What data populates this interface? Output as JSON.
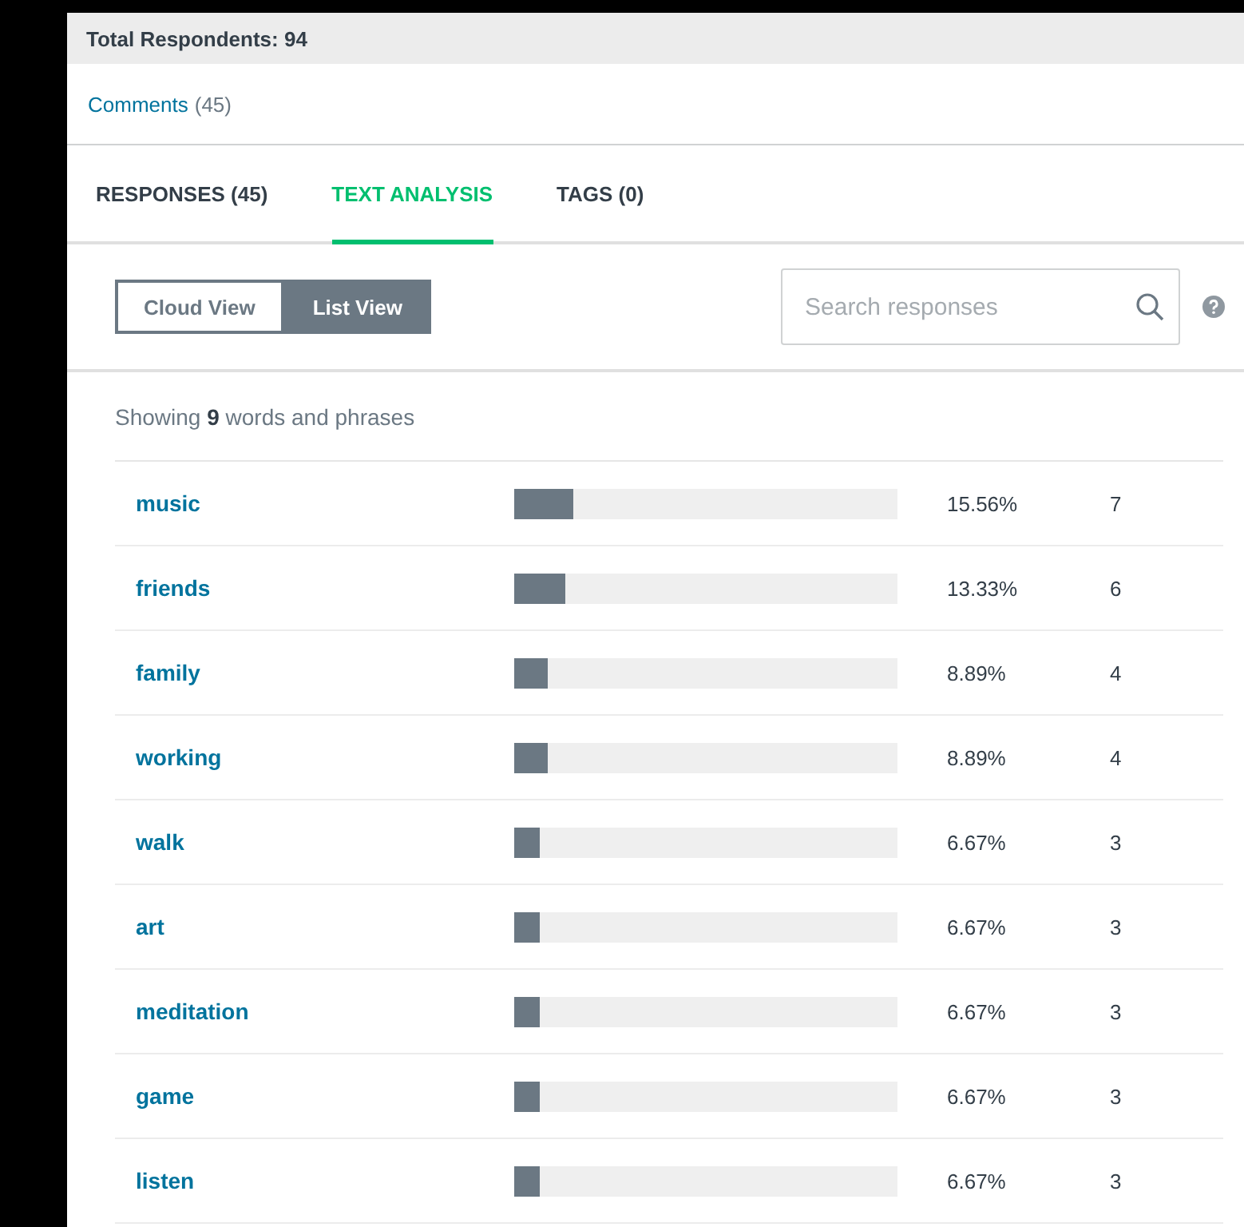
{
  "header": {
    "total": "Total Respondents: 94"
  },
  "comments": {
    "link": "Comments",
    "count": "(45)"
  },
  "tabs": [
    {
      "label": "RESPONSES (45)",
      "selected": false
    },
    {
      "label": "TEXT ANALYSIS",
      "selected": true
    },
    {
      "label": "TAGS (0)",
      "selected": false
    }
  ],
  "view_toggle": [
    {
      "label": "Cloud View",
      "selected": false
    },
    {
      "label": "List View",
      "selected": true
    }
  ],
  "search": {
    "placeholder": "Search responses"
  },
  "summary": "Showing **9** words and phrases",
  "words": [
    {
      "word": "music",
      "level": 0.1556,
      "percent": "15.56%",
      "count": "7"
    },
    {
      "word": "friends",
      "level": 0.1333,
      "percent": "13.33%",
      "count": "6"
    },
    {
      "word": "family",
      "level": 0.0889,
      "percent": "8.89%",
      "count": "4"
    },
    {
      "word": "working",
      "level": 0.0889,
      "percent": "8.89%",
      "count": "4"
    },
    {
      "word": "walk",
      "level": 0.0667,
      "percent": "6.67%",
      "count": "3"
    },
    {
      "word": "art",
      "level": 0.0667,
      "percent": "6.67%",
      "count": "3"
    },
    {
      "word": "meditation",
      "level": 0.0667,
      "percent": "6.67%",
      "count": "3"
    },
    {
      "word": "game",
      "level": 0.0667,
      "percent": "6.67%",
      "count": "3"
    },
    {
      "word": "listen",
      "level": 0.0667,
      "percent": "6.67%",
      "count": "3"
    }
  ]
}
